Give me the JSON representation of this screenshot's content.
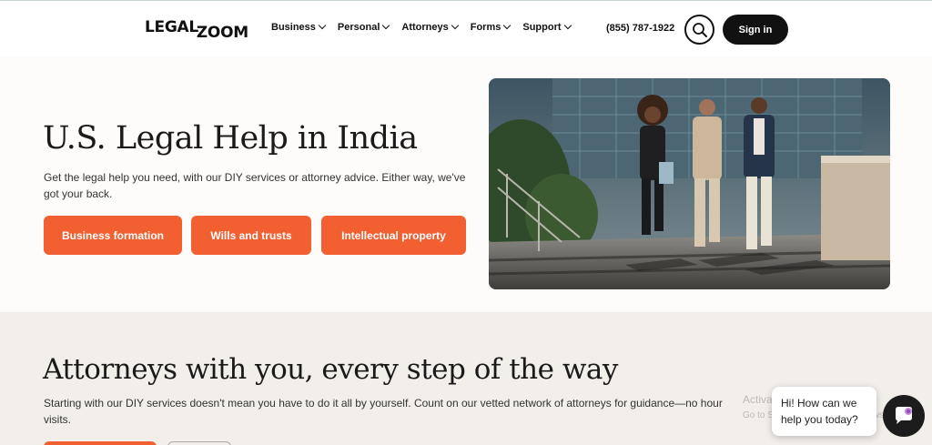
{
  "header": {
    "logo_text_1": "LEGAL",
    "logo_text_2": "ZOOM",
    "nav": [
      {
        "label": "Business"
      },
      {
        "label": "Personal"
      },
      {
        "label": "Attorneys"
      },
      {
        "label": "Forms"
      },
      {
        "label": "Support"
      }
    ],
    "phone": "(855) 787-1922",
    "signin_label": "Sign in"
  },
  "hero": {
    "title": "U.S. Legal Help in India",
    "description": "Get the legal help you need, with our DIY services or attorney advice. Either way, we've got your back.",
    "buttons": [
      {
        "label": "Business formation"
      },
      {
        "label": "Wills and trusts"
      },
      {
        "label": "Intellectual property"
      }
    ]
  },
  "attorneys": {
    "title": "Attorneys with you, every step of the way",
    "description": "Starting with our DIY services doesn't mean you have to do it all by yourself. Count on our vetted network of attorneys for guidance—no hour",
    "description_2": "visits."
  },
  "chat": {
    "message": "Hi! How can we help you today?"
  },
  "watermark": {
    "line1": "Activate Windows",
    "line2": "Go to Settings to activate Windows."
  },
  "colors": {
    "accent": "#f25f30",
    "dark": "#111111",
    "hero_bg": "#fdfcfa",
    "section_bg": "#f2eeea"
  },
  "icons": {
    "search": "search-icon",
    "chevron": "chevron-down-icon",
    "chat": "chat-icon"
  }
}
